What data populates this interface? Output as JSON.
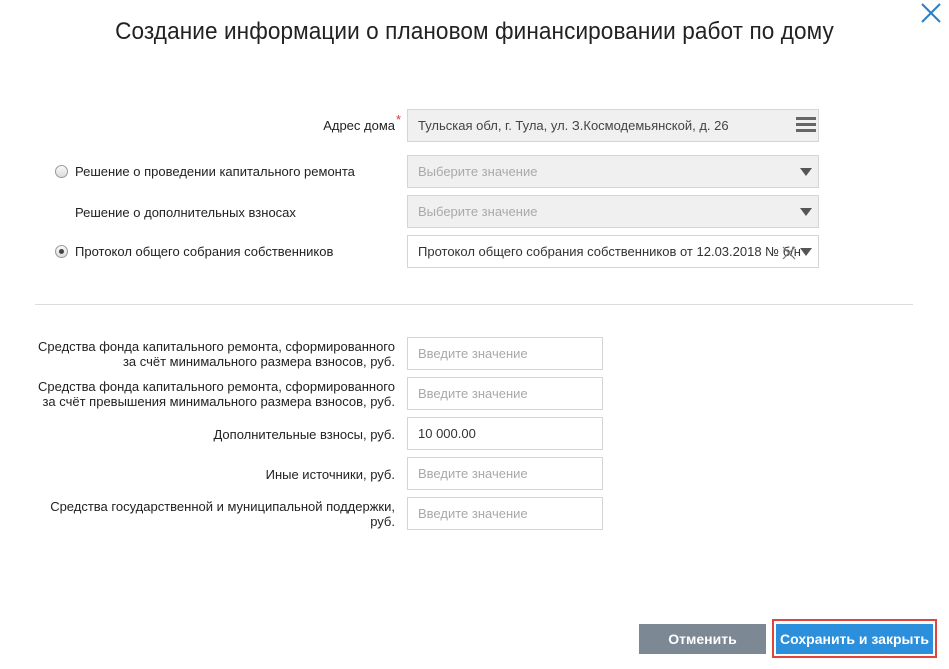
{
  "dialog": {
    "title": "Создание информации о плановом финансировании работ по дому"
  },
  "address": {
    "label": "Адрес дома",
    "required_mark": "*",
    "value": "Тульская обл, г. Тула, ул. З.Космодемьянской, д. 26"
  },
  "decision_capital": {
    "label": "Решение о проведении капитального ремонта",
    "placeholder": "Выберите значение",
    "selected": false
  },
  "decision_extra": {
    "label": "Решение о дополнительных взносах",
    "placeholder": "Выберите значение"
  },
  "protocol": {
    "label": "Протокол общего собрания собственников",
    "value": "Протокол общего собрания собственников от 12.03.2018 № б/н",
    "selected": true
  },
  "funding": [
    {
      "label_line1": "Средства фонда капитального ремонта, сформированного",
      "label_line2": "за счёт минимального размера взносов, руб.",
      "value": "",
      "placeholder": "Введите значение"
    },
    {
      "label_line1": "Средства фонда капитального ремонта, сформированного",
      "label_line2": "за счёт превышения минимального размера взносов, руб.",
      "value": "",
      "placeholder": "Введите значение"
    },
    {
      "label_line1": "Дополнительные взносы, руб.",
      "label_line2": "",
      "value": "10 000.00",
      "placeholder": "Введите значение"
    },
    {
      "label_line1": "Иные источники, руб.",
      "label_line2": "",
      "value": "",
      "placeholder": "Введите значение"
    },
    {
      "label_line1": "Средства государственной и муниципальной поддержки,",
      "label_line2": "руб.",
      "value": "",
      "placeholder": "Введите значение"
    }
  ],
  "buttons": {
    "cancel": "Отменить",
    "save": "Сохранить и закрыть"
  },
  "colors": {
    "cancel_bg": "#7d8895",
    "save_bg": "#2c8fdc",
    "highlight_border": "#e0443a",
    "close_icon": "#2a7fc9"
  }
}
